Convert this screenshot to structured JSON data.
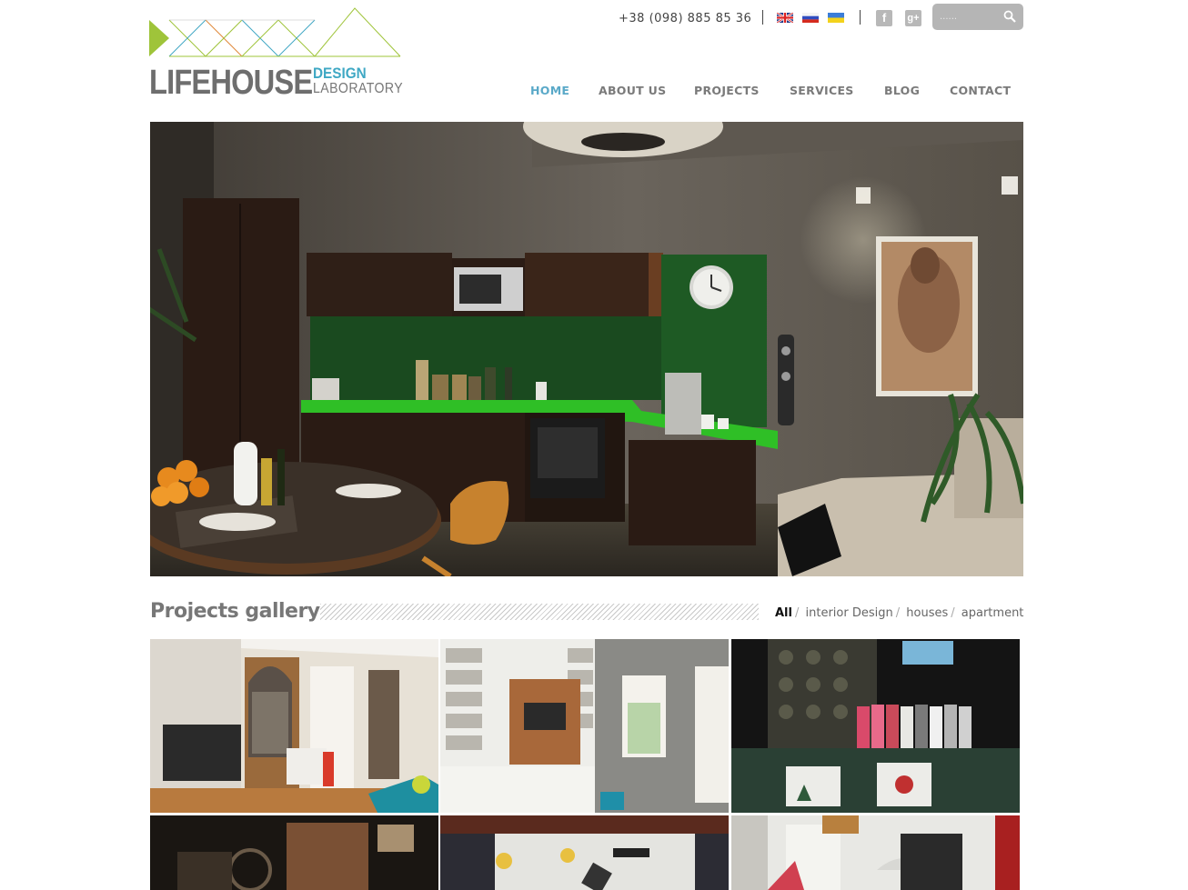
{
  "brand": {
    "name": "LIFEHOUSE",
    "tagline_line1": "DESIGN",
    "tagline_line2": "LABORATORY",
    "accent_color": "#3fa8c4"
  },
  "topbar": {
    "phone": "+38 (098) 885 85 36",
    "languages": [
      "English",
      "Russian",
      "Ukrainian"
    ],
    "social": [
      {
        "icon": "facebook-icon",
        "glyph": "f"
      },
      {
        "icon": "google-plus-icon",
        "glyph": "g+"
      }
    ],
    "search": {
      "placeholder": "......",
      "icon": "search-icon"
    }
  },
  "nav": {
    "items": [
      {
        "label": "HOME",
        "active": true
      },
      {
        "label": "ABOUT US",
        "active": false
      },
      {
        "label": "PROJECTS",
        "active": false
      },
      {
        "label": "SERVICES",
        "active": false
      },
      {
        "label": "BLOG",
        "active": false
      },
      {
        "label": "CONTACT",
        "active": false
      }
    ],
    "active_color": "#5aa9c8"
  },
  "hero": {
    "subject": "kitchen interior render"
  },
  "gallery": {
    "title": "Projects gallery",
    "filters": [
      {
        "label": "All",
        "active": true
      },
      {
        "label": "interior Design",
        "active": false
      },
      {
        "label": "houses",
        "active": false
      },
      {
        "label": "apartment",
        "active": false
      }
    ],
    "tiles": [
      {
        "subject": "living room with tv"
      },
      {
        "subject": "bookshelf wall with tv"
      },
      {
        "subject": "dark showroom with clothing rack"
      },
      {
        "subject": "dark loft interior"
      },
      {
        "subject": "cafe with brick wall"
      },
      {
        "subject": "bright kitchen with pendant lamp"
      }
    ]
  }
}
